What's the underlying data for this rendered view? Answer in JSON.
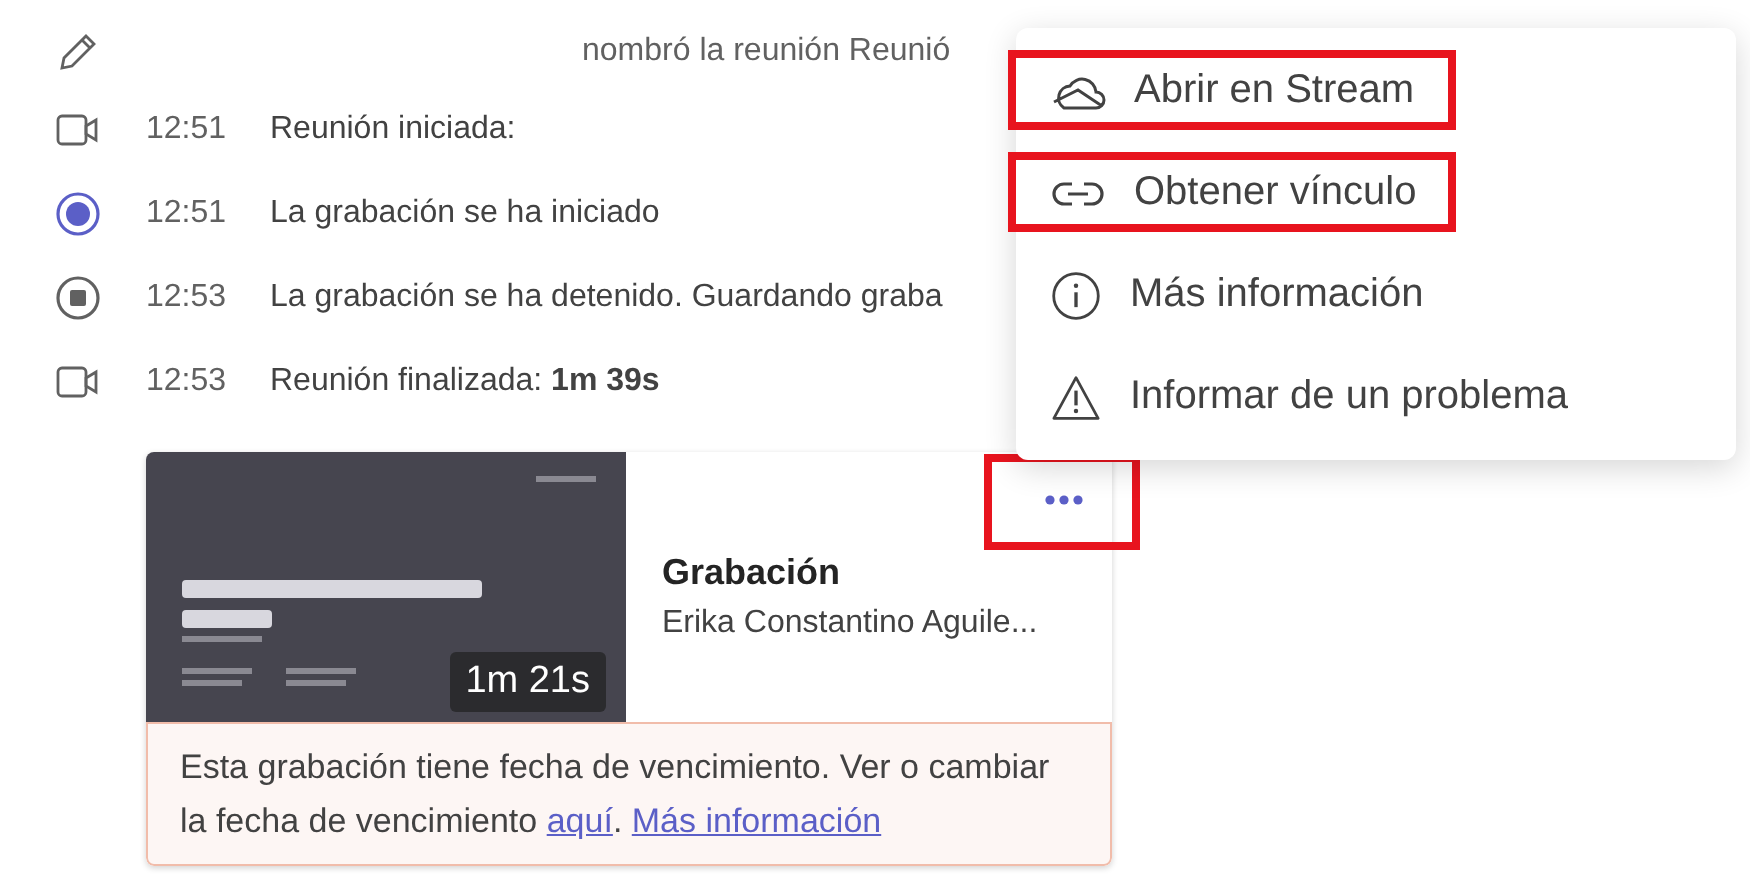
{
  "events": [
    {
      "kind": "rename",
      "text": "nombró la reunión Reunió"
    },
    {
      "kind": "meeting",
      "time": "12:51",
      "text": "Reunión iniciada:"
    },
    {
      "kind": "rec-start",
      "time": "12:51",
      "text": "La grabación se ha iniciado"
    },
    {
      "kind": "rec-stop",
      "time": "12:53",
      "text": "La grabación se ha detenido. Guardando graba"
    },
    {
      "kind": "meeting",
      "time": "12:53",
      "text": "Reunión finalizada: **1m 39s**"
    }
  ],
  "recording": {
    "duration": "1m 21s",
    "title": "Grabación",
    "owner": "Erika Constantino Aguile...",
    "more_highlighted": true,
    "notice": {
      "text": "Esta grabación tiene fecha de vencimiento. Ver o cambiar la fecha de vencimiento",
      "link": "aquí",
      "link_end": ".",
      "link2": "Más información"
    }
  },
  "menu": {
    "items": [
      {
        "kind": "cloud",
        "label": "Abrir en Stream",
        "highlighted": true
      },
      {
        "kind": "link",
        "label": "Obtener vínculo",
        "highlighted": true
      },
      {
        "kind": "info",
        "label": "Más información",
        "highlighted": false
      },
      {
        "kind": "warning",
        "label": "Informar de un problema",
        "highlighted": false
      }
    ]
  }
}
